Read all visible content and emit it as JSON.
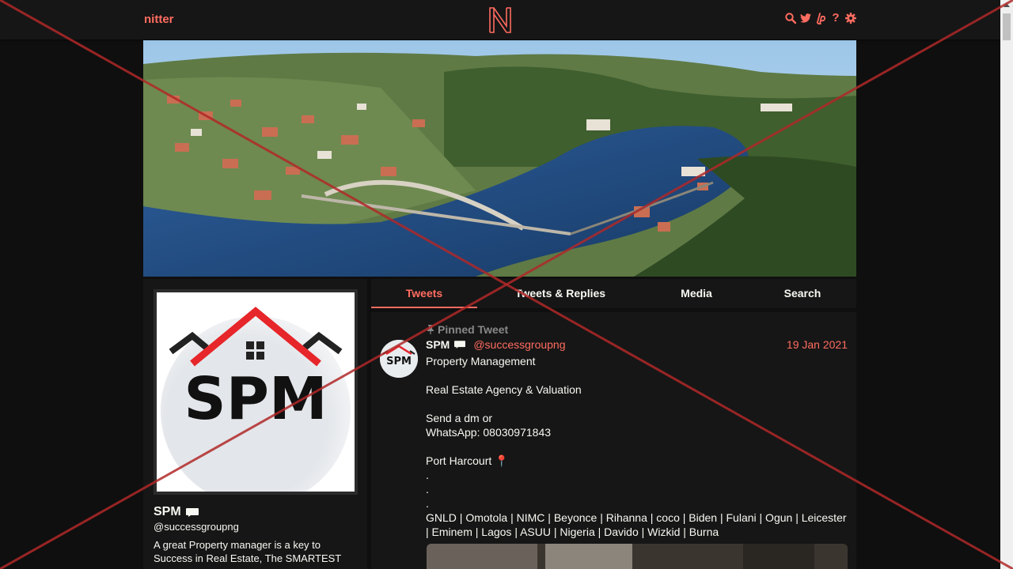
{
  "navbar": {
    "brand": "nitter",
    "icons": [
      "search-icon",
      "twitter-bird-icon",
      "liberapay-icon",
      "help-icon",
      "gear-icon"
    ],
    "help_glyph": "?"
  },
  "banner": {
    "alt": "banner"
  },
  "profile": {
    "fullname": "SPM",
    "username": "@successgroupng",
    "bio": "A great Property manager is a key to Success in Real Estate, The SMARTEST",
    "avatar_text": "SPM"
  },
  "tabs": [
    {
      "label": "Tweets",
      "active": true
    },
    {
      "label": "Tweets & Replies",
      "active": false
    },
    {
      "label": "Media",
      "active": false
    },
    {
      "label": "Search",
      "active": false
    }
  ],
  "tweet": {
    "pinned_label": "Pinned Tweet",
    "fullname": "SPM",
    "username": "@successgroupng",
    "date": "19 Jan 2021",
    "body": "Property Management\n\nReal Estate Agency & Valuation\n\nSend a dm or\nWhatsApp: 08030971843\n\nPort Harcourt 📍\n.\n.\n.\nGNLD | Omotola | NIMC | Beyonce | Rihanna | coco | Biden | Fulani | Ogun | Leicester\n| Eminem | Lagos | ASUU | Nigeria | Davido | Wizkid | Burna",
    "avatar_text": "SPM"
  },
  "colors": {
    "accent": "#ff6c60",
    "background": "#0f0f0f",
    "panel": "#161616",
    "text": "#f8f8f2",
    "cross": "#b02828"
  }
}
